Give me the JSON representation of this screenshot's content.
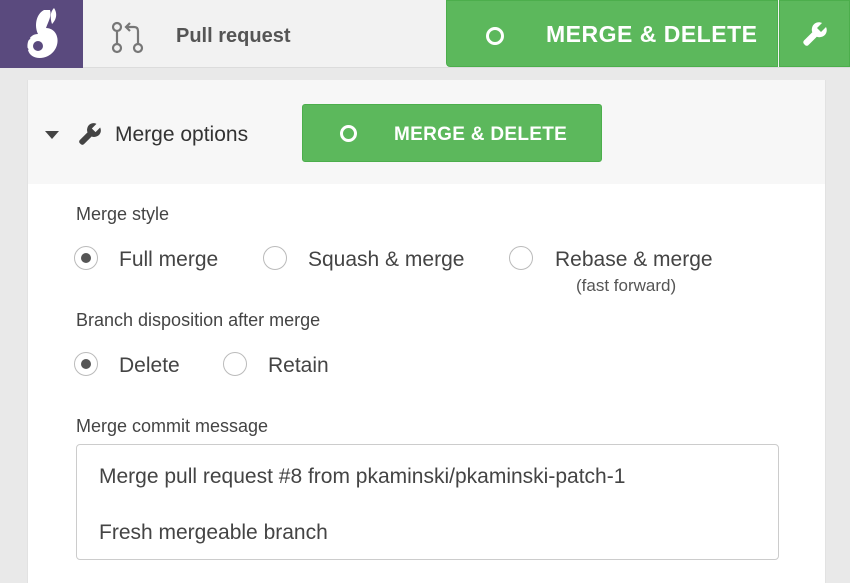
{
  "header": {
    "title": "Pull request",
    "merge_button_label": "MERGE & DELETE",
    "icons": {
      "logo": "rabbit-logo",
      "pull_request": "pull-request-icon",
      "settings": "wrench-icon"
    }
  },
  "panel": {
    "title": "Merge options",
    "merge_button_label": "MERGE & DELETE",
    "merge_style": {
      "label": "Merge style",
      "options": [
        {
          "label": "Full merge",
          "sub": "",
          "checked": true
        },
        {
          "label": "Squash & merge",
          "sub": "",
          "checked": false
        },
        {
          "label": "Rebase & merge",
          "sub": "(fast forward)",
          "checked": false
        }
      ]
    },
    "branch_disposition": {
      "label": "Branch disposition after merge",
      "options": [
        {
          "label": "Delete",
          "checked": true
        },
        {
          "label": "Retain",
          "checked": false
        }
      ]
    },
    "commit_message": {
      "label": "Merge commit message",
      "value": "Merge pull request #8 from pkaminski/pkaminski-patch-1\n\nFresh mergeable branch"
    }
  },
  "colors": {
    "brand": "#5a4a7e",
    "success": "#5cb85c"
  }
}
